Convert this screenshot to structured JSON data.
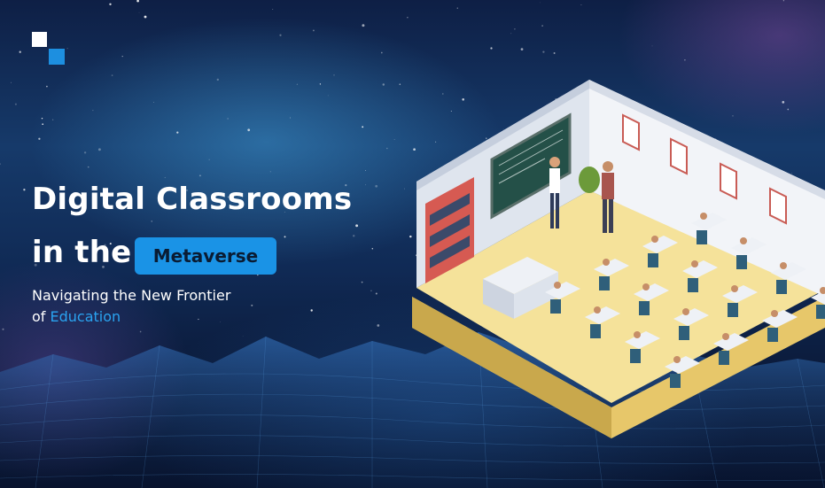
{
  "banner": {
    "headline_line1": "Digital Classrooms",
    "headline_line2": "in the",
    "highlight": "Metaverse",
    "subtitle_line1": "Navigating the New Frontier",
    "subtitle_prefix": "of",
    "subtitle_accent": "Education"
  },
  "colors": {
    "accent": "#1a93e6",
    "accent_text": "#2aa3f0",
    "background": "#0e1f45",
    "floor": "#f5e29a",
    "wall": "#f2f4f8"
  },
  "icons": [
    "logo-mark",
    "classroom-illustration",
    "starfield",
    "wireframe-terrain"
  ]
}
